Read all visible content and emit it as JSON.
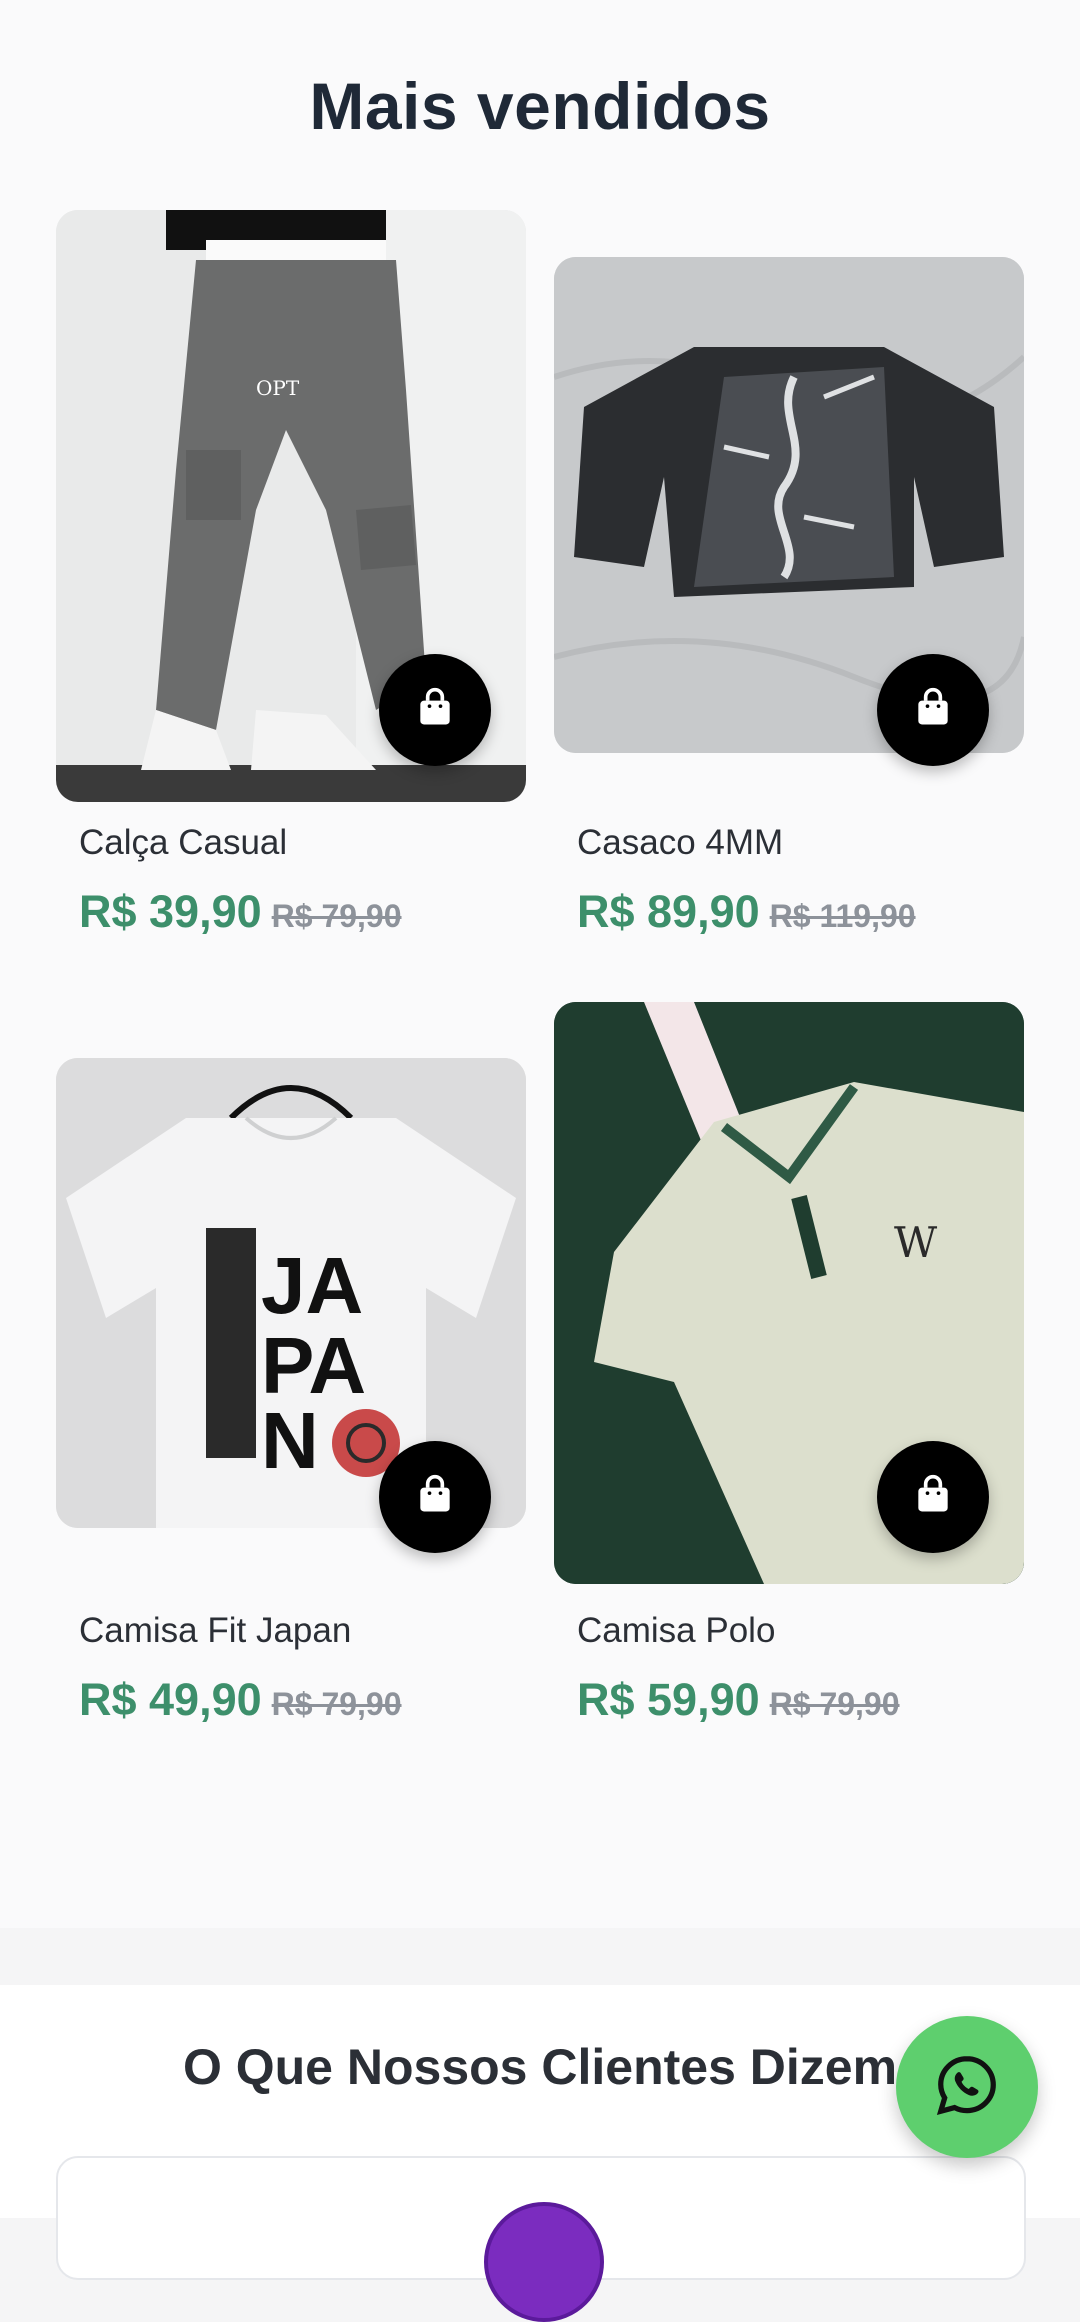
{
  "best_sellers": {
    "title": "Mais vendidos",
    "products": [
      {
        "name": "Calça Casual",
        "price": "R$ 39,90",
        "old_price": "R$ 79,90",
        "image_icon": "cargo-pants-photo"
      },
      {
        "name": "Casaco 4MM",
        "price": "R$ 89,90",
        "old_price": "R$ 119,90",
        "image_icon": "graphic-tee-photo"
      },
      {
        "name": "Camisa Fit Japan",
        "price": "R$ 49,90",
        "old_price": "R$ 79,90",
        "image_icon": "japan-tee-photo"
      },
      {
        "name": "Camisa Polo",
        "price": "R$ 59,90",
        "old_price": "R$ 79,90",
        "image_icon": "polo-shirt-photo"
      }
    ],
    "cart_icon": "shopping-bag-icon"
  },
  "testimonials": {
    "title": "O Que Nossos Clientes Dizem"
  },
  "whatsapp": {
    "icon": "whatsapp-icon"
  },
  "colors": {
    "price_green": "#3d8f6b",
    "old_price_gray": "#8d929a",
    "cart_button": "#000000",
    "whatsapp_green": "#5ecf6e",
    "polo_background": "#1f3d2f"
  }
}
